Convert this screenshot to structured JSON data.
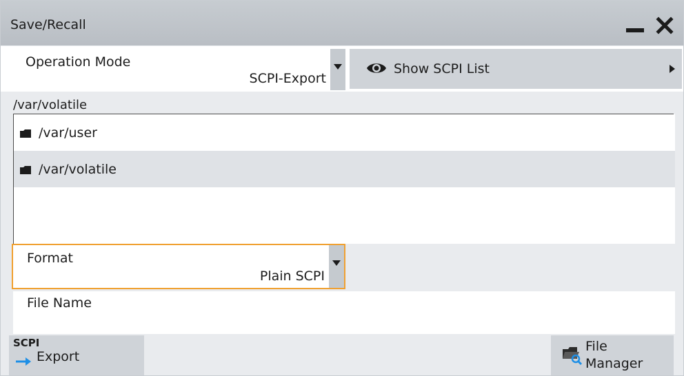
{
  "dialog": {
    "title": "Save/Recall"
  },
  "operation_mode": {
    "label": "Operation Mode",
    "value": "SCPI-Export"
  },
  "show_scpi_list": {
    "label": "Show SCPI List"
  },
  "directory": {
    "current_path": "/var/volatile",
    "items": [
      {
        "name": "/var/user"
      },
      {
        "name": "/var/volatile"
      }
    ]
  },
  "format": {
    "label": "Format",
    "value": "Plain SCPI"
  },
  "file_name": {
    "label": "File Name",
    "value": ""
  },
  "buttons": {
    "export_badge": "SCPI",
    "export_label": "Export",
    "file_manager_line1": "File",
    "file_manager_line2": "Manager"
  },
  "colors": {
    "focus_border": "#f0a030",
    "arrow_blue": "#1e8fe6",
    "title_bar": "#c1c6cc"
  }
}
